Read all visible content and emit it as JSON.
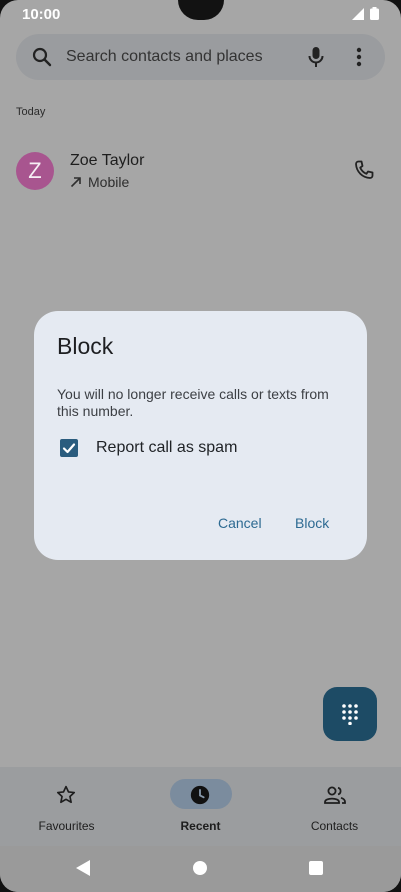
{
  "status": {
    "time": "10:00"
  },
  "search": {
    "placeholder": "Search contacts and places"
  },
  "recents": {
    "section_label": "Today",
    "items": [
      {
        "avatar_letter": "Z",
        "name": "Zoe Taylor",
        "direction_icon": "outgoing-arrow-icon",
        "type": "Mobile"
      }
    ]
  },
  "dialog": {
    "title": "Block",
    "message": "You will no longer receive calls or texts from this number.",
    "checkbox_label": "Report call as spam",
    "checkbox_checked": true,
    "cancel_label": "Cancel",
    "confirm_label": "Block"
  },
  "bottom_nav": {
    "items": [
      {
        "label": "Favourites",
        "icon": "star-icon",
        "active": false
      },
      {
        "label": "Recent",
        "icon": "clock-icon",
        "active": true
      },
      {
        "label": "Contacts",
        "icon": "people-icon",
        "active": false
      }
    ]
  },
  "colors": {
    "scrim_background": "#a6a6a6",
    "dialog_background": "#e5eaf2",
    "accent": "#2a5c7e",
    "avatar": "#a8558f",
    "fab": "#1d4b65"
  }
}
